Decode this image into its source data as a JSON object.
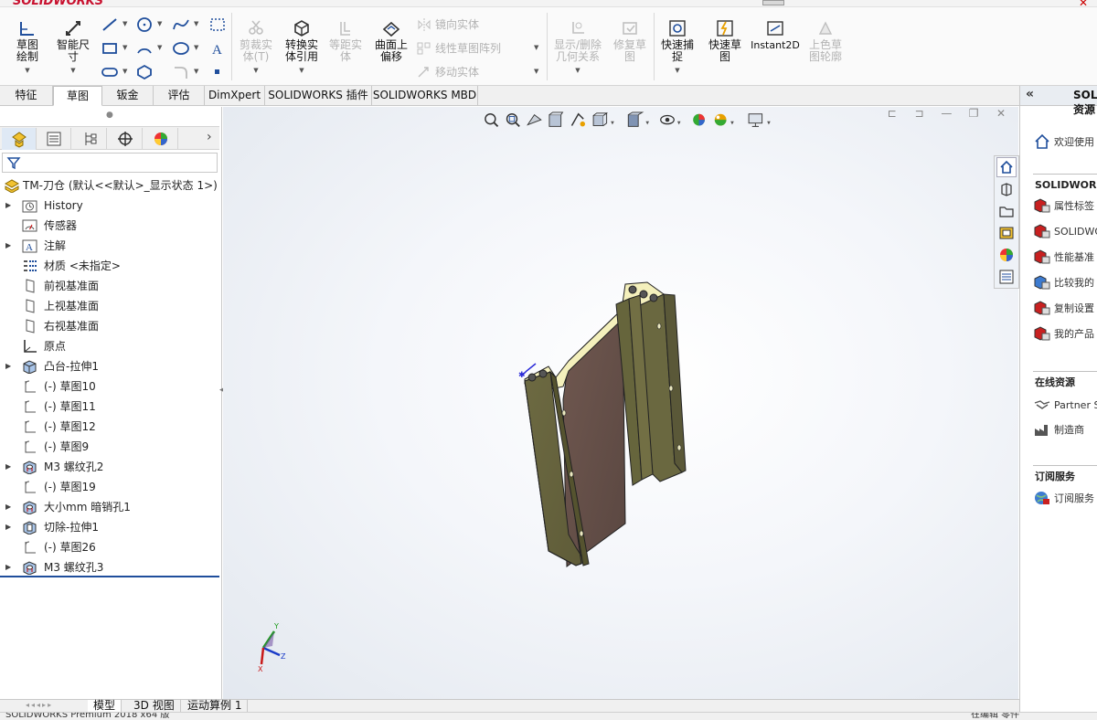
{
  "app": {
    "logo": "SOLIDWORKS"
  },
  "ribbon": {
    "sketch": "草图绘制",
    "smart_dim": "智能尺寸",
    "trim": "剪裁实体(T)",
    "convert": "转换实体引用",
    "offset": "等距实体",
    "offset_surface": "曲面上偏移",
    "mirror": "镜向实体",
    "linear_pattern": "线性草图阵列",
    "move": "移动实体",
    "display_delete": "显示/删除几何关系",
    "repair": "修复草图",
    "quick_snap": "快速捕捉",
    "rapid_sketch": "快速草图",
    "instant2d": "Instant2D",
    "shaded_contours": "上色草图轮廓"
  },
  "tabs": [
    "特征",
    "草图",
    "钣金",
    "评估",
    "DimXpert",
    "SOLIDWORKS 插件",
    "SOLIDWORKS MBD"
  ],
  "active_tab": "草图",
  "tree": {
    "root": "TM-刀仓 (默认<<默认>_显示状态 1>)",
    "items": [
      {
        "label": "History",
        "icon": "history-folder-icon",
        "expand": true,
        "indent": 1
      },
      {
        "label": "传感器",
        "icon": "sensor-icon",
        "expand": false,
        "indent": 1
      },
      {
        "label": "注解",
        "icon": "annotation-icon",
        "expand": true,
        "indent": 1
      },
      {
        "label": "材质 <未指定>",
        "icon": "material-icon",
        "expand": false,
        "indent": 1
      },
      {
        "label": "前视基准面",
        "icon": "plane-icon",
        "expand": false,
        "indent": 1
      },
      {
        "label": "上视基准面",
        "icon": "plane-icon",
        "expand": false,
        "indent": 1
      },
      {
        "label": "右视基准面",
        "icon": "plane-icon",
        "expand": false,
        "indent": 1
      },
      {
        "label": "原点",
        "icon": "origin-icon",
        "expand": false,
        "indent": 1
      },
      {
        "label": "凸台-拉伸1",
        "icon": "extrude-icon",
        "expand": true,
        "indent": 1
      },
      {
        "label": "(-) 草图10",
        "icon": "sketch-icon",
        "expand": false,
        "indent": 1
      },
      {
        "label": "(-) 草图11",
        "icon": "sketch-icon",
        "expand": false,
        "indent": 1
      },
      {
        "label": "(-) 草图12",
        "icon": "sketch-icon",
        "expand": false,
        "indent": 1
      },
      {
        "label": "(-) 草图9",
        "icon": "sketch-icon",
        "expand": false,
        "indent": 1
      },
      {
        "label": "M3 螺纹孔2",
        "icon": "hole-wizard-icon",
        "expand": true,
        "indent": 1
      },
      {
        "label": "(-) 草图19",
        "icon": "sketch-icon",
        "expand": false,
        "indent": 1
      },
      {
        "label": "大小mm 暗销孔1",
        "icon": "hole-wizard-icon",
        "expand": true,
        "indent": 1
      },
      {
        "label": "切除-拉伸1",
        "icon": "cut-extrude-icon",
        "expand": true,
        "indent": 1
      },
      {
        "label": "(-) 草图26",
        "icon": "sketch-icon",
        "expand": false,
        "indent": 1
      },
      {
        "label": "M3 螺纹孔3",
        "icon": "hole-wizard-icon",
        "expand": true,
        "indent": 1
      }
    ]
  },
  "bottom_tabs": [
    "模型",
    "3D 视图",
    "运动算例 1"
  ],
  "status": {
    "left": "SOLIDWORKS Premium 2018 x64 版",
    "right": "在编辑 零件"
  },
  "taskpane": {
    "title": "SOLIDWORKS资源",
    "welcome": "欢迎使用",
    "section1": "SOLIDWORKS工具",
    "items1": [
      "属性标签",
      "SOLIDWORKS Rx",
      "性能基准",
      "比较我的",
      "复制设置",
      "我的产品"
    ],
    "section2": "在线资源",
    "items2": [
      "Partner Solutions",
      "制造商"
    ],
    "section3": "订阅服务",
    "items3": [
      "订阅服务"
    ]
  },
  "triad": {
    "x": "X",
    "y": "Y",
    "z": "Z"
  }
}
